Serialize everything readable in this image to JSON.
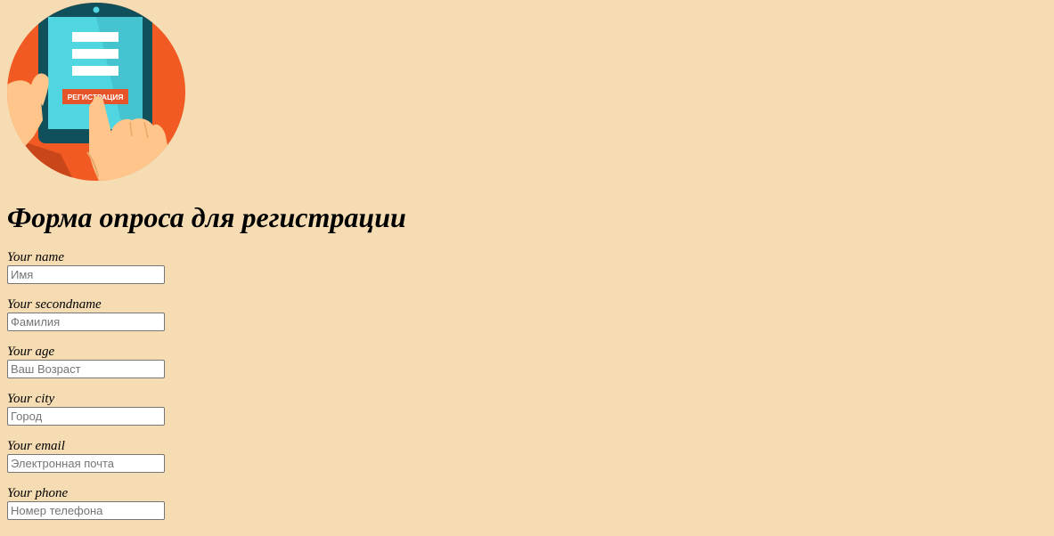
{
  "logo": {
    "badge_text": "РЕГИСТРАЦИЯ",
    "colors": {
      "circle": "#f15a22",
      "tablet_frame": "#10505a",
      "screen": "#4fd6e0",
      "button": "#e8542a",
      "skin": "#ffc58a"
    }
  },
  "page_title": "Форма опроса для регистрации",
  "form": {
    "fields": [
      {
        "label": "Your name",
        "placeholder": "Имя"
      },
      {
        "label": "Your secondname",
        "placeholder": "Фамилия"
      },
      {
        "label": "Your age",
        "placeholder": "Ваш Возраст"
      },
      {
        "label": "Your city",
        "placeholder": "Город"
      },
      {
        "label": "Your email",
        "placeholder": "Электронная почта"
      },
      {
        "label": "Your phone",
        "placeholder": "Номер телефона"
      }
    ]
  },
  "colors": {
    "background": "#f5dcb3"
  }
}
